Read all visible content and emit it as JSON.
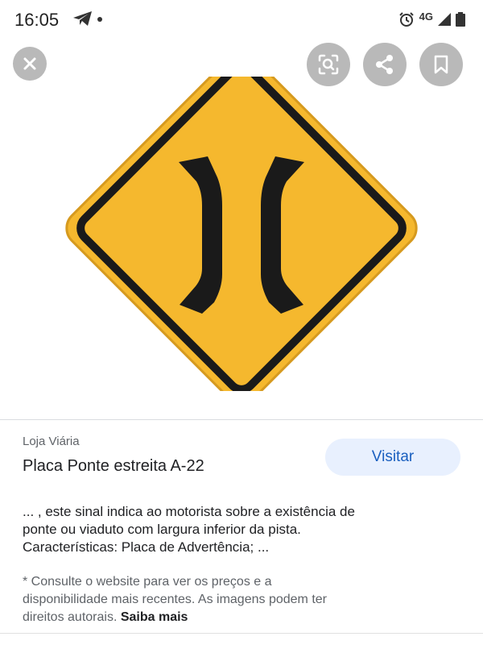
{
  "status_bar": {
    "time": "16:05",
    "network": "4G",
    "icons": [
      "telegram-icon",
      "alarm-icon",
      "signal-icon",
      "battery-icon"
    ]
  },
  "top_actions": {
    "icons": [
      "close-icon",
      "lens-search-icon",
      "share-icon",
      "bookmark-icon"
    ]
  },
  "sign_image": {
    "icon": "narrow-bridge-sign",
    "colors": {
      "yellow": "#f5b82e",
      "border": "#1a1a1a"
    }
  },
  "result": {
    "source": "Loja Viária",
    "title": "Placa Ponte estreita A-22",
    "visit_label": "Visitar",
    "description_lines": [
      "... , este sinal indica ao motorista sobre a existência de",
      "ponte ou viaduto com largura inferior da pista.",
      "Características: Placa de Advertência; ..."
    ],
    "disclaimer_lines": [
      "* Consulte o website para ver os preços e a",
      "disponibilidade mais recentes. As imagens podem ter",
      "direitos autorais. "
    ],
    "learn_more": "Saiba mais"
  },
  "colors": {
    "visit_bg": "#e8f0fe",
    "visit_text": "#1a5fbf",
    "action_button_bg": "#b9b9b9"
  }
}
